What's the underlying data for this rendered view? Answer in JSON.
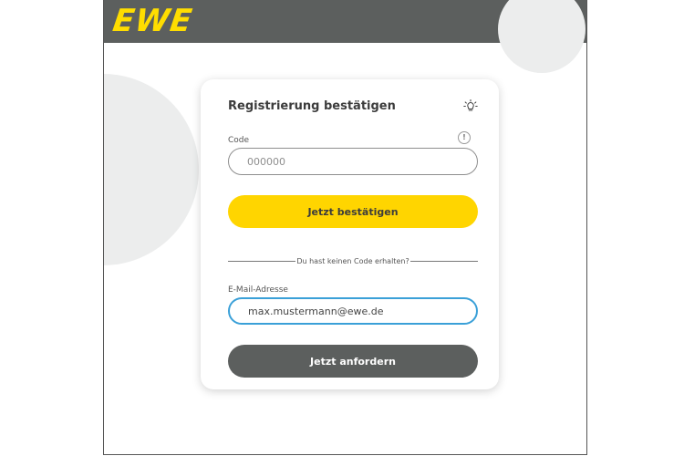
{
  "header": {
    "logo_text": "EWE",
    "brand_color": "#ffdd00",
    "bar_color": "#5c5f5e"
  },
  "card": {
    "title": "Registrierung bestätigen",
    "help_icon": "lightbulb-icon",
    "code_field": {
      "label": "Code",
      "placeholder": "000000",
      "info_icon": "info-icon",
      "info_glyph": "!"
    },
    "confirm_button": {
      "label": "Jetzt bestätigen",
      "color": "#ffd500"
    },
    "divider_text": "Du hast keinen Code erhalten?",
    "email_field": {
      "label": "E-Mail-Adresse",
      "value": "max.mustermann@ewe.de",
      "focus_color": "#3aa0d8"
    },
    "request_button": {
      "label": "Jetzt anfordern",
      "color": "#5c5f5e"
    }
  }
}
